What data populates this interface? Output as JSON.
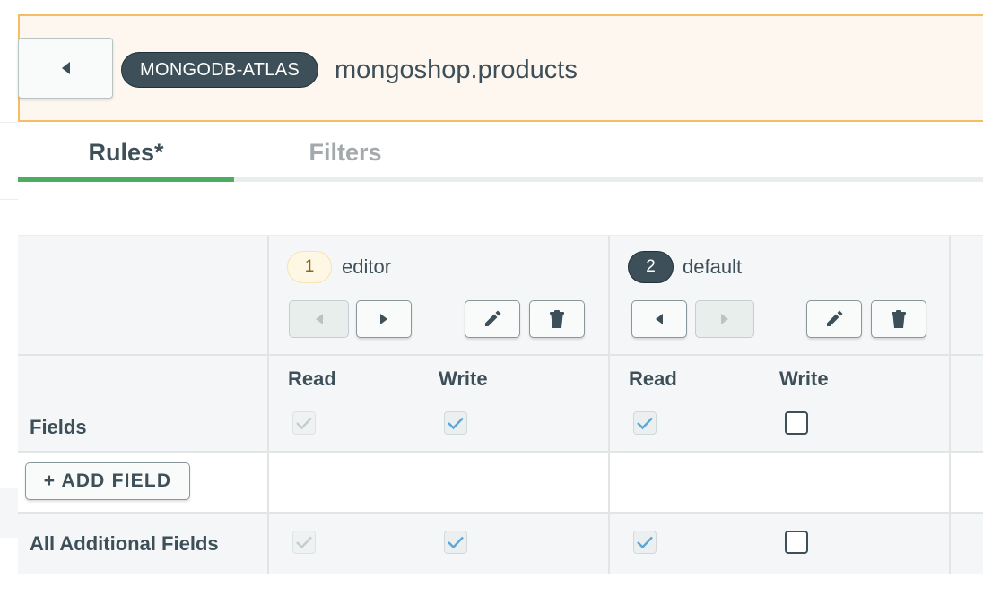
{
  "header": {
    "service_badge": "MONGODB-ATLAS",
    "collection_title": "mongoshop.products"
  },
  "tabs": [
    {
      "label": "Rules*",
      "active": true
    },
    {
      "label": "Filters",
      "active": false
    }
  ],
  "roles": [
    {
      "order": "1",
      "name": "editor",
      "pill_style": "light",
      "prev_disabled": true,
      "next_disabled": false
    },
    {
      "order": "2",
      "name": "default",
      "pill_style": "dark",
      "prev_disabled": false,
      "next_disabled": true
    }
  ],
  "columns": {
    "read": "Read",
    "write": "Write"
  },
  "rows": {
    "fields": {
      "label": "Fields",
      "permissions": [
        {
          "role": "editor",
          "read": "checked-disabled",
          "write": "checked"
        },
        {
          "role": "default",
          "read": "checked",
          "write": "unchecked"
        }
      ]
    },
    "add_field_button": "+ ADD FIELD",
    "all_additional_fields": {
      "label": "All Additional Fields",
      "permissions": [
        {
          "role": "editor",
          "read": "checked-disabled",
          "write": "checked"
        },
        {
          "role": "default",
          "read": "checked",
          "write": "unchecked"
        }
      ]
    }
  },
  "icons": {
    "back": "caret-left-icon",
    "prev": "caret-left-icon",
    "next": "caret-right-icon",
    "edit": "pencil-icon",
    "delete": "trash-icon",
    "check": "check-icon"
  },
  "colors": {
    "banner_bg": "#fef7ef",
    "banner_border": "#f5be62",
    "tab_active": "#4aad62",
    "badge_dark": "#3d4f58",
    "check_mark": "#5aa7d8",
    "check_mark_disabled": "#c3ccce"
  }
}
